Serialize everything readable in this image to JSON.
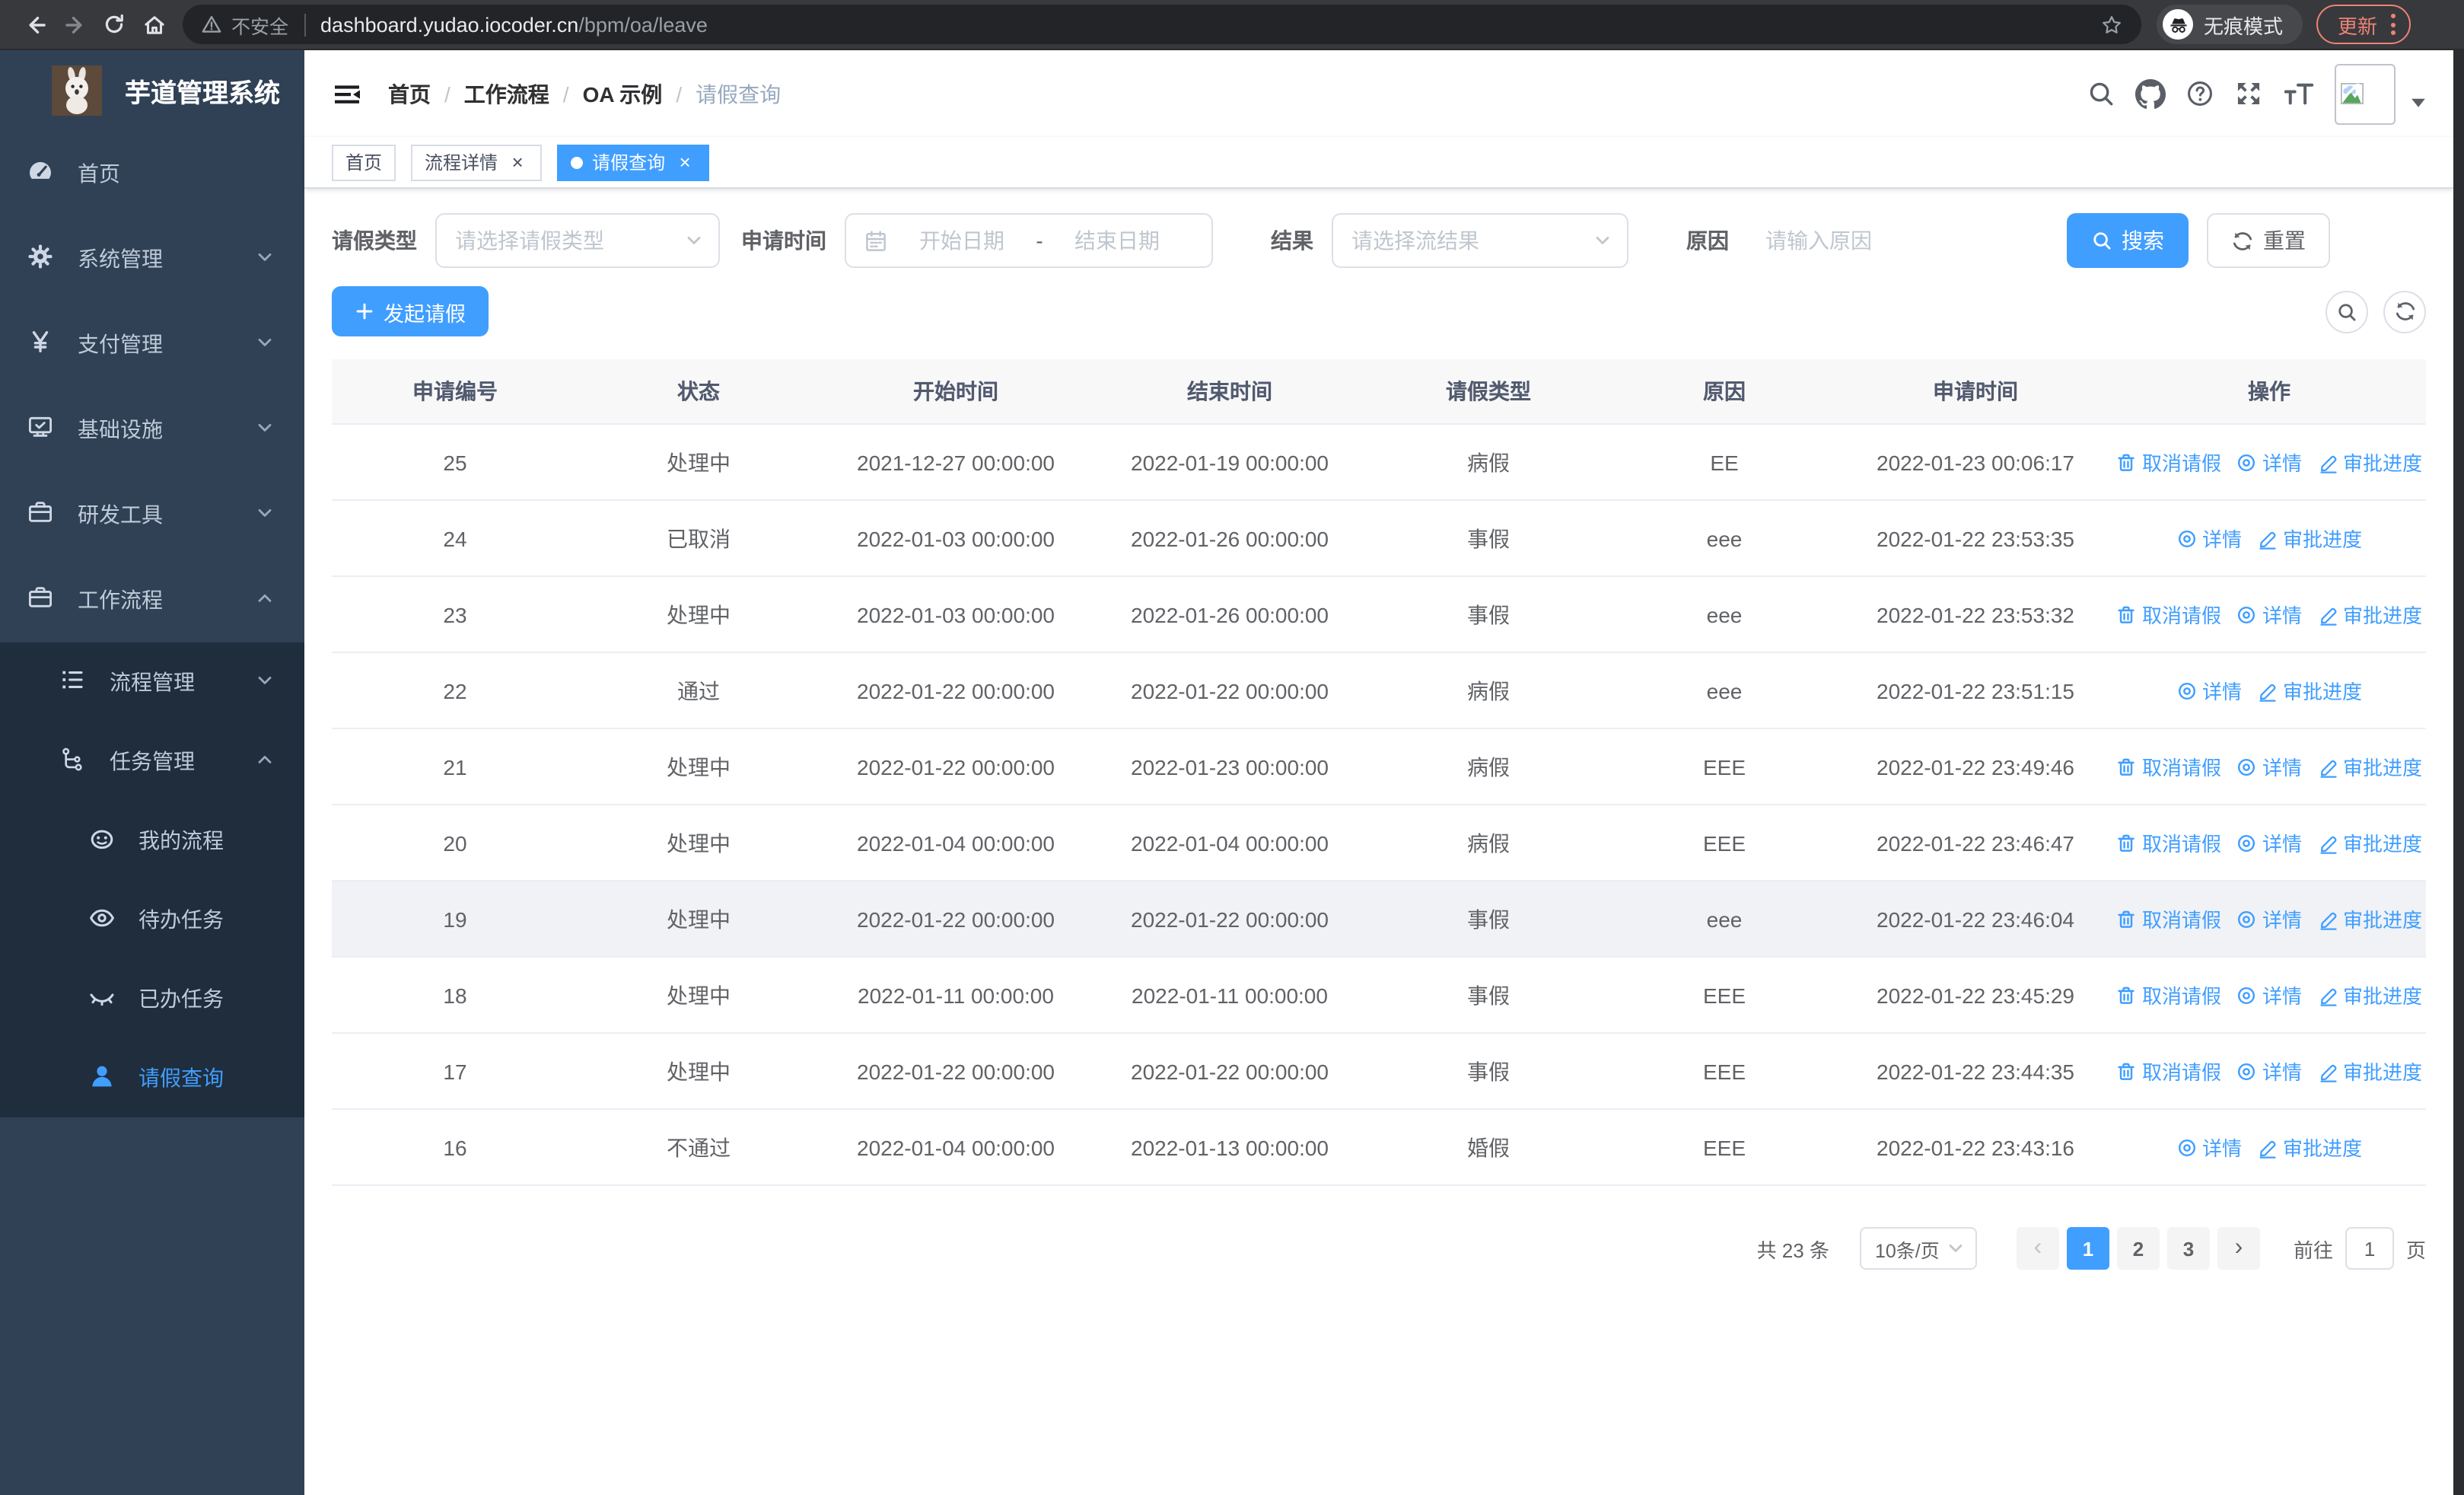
{
  "browser": {
    "security_label": "不安全",
    "url_host": "dashboard.yudao.iocoder.cn",
    "url_path": "/bpm/oa/leave",
    "incognito_label": "无痕模式",
    "update_label": "更新"
  },
  "app": {
    "title": "芋道管理系统"
  },
  "sidebar": {
    "menu": [
      {
        "name": "home",
        "label": "首页",
        "icon": "dashboard-icon",
        "arrow": null,
        "active": false
      },
      {
        "name": "system",
        "label": "系统管理",
        "icon": "gear-icon",
        "arrow": "down",
        "active": false
      },
      {
        "name": "payment",
        "label": "支付管理",
        "icon": "yen-icon",
        "arrow": "down",
        "active": false
      },
      {
        "name": "infrastructure",
        "label": "基础设施",
        "icon": "monitor-icon",
        "arrow": "down",
        "active": false
      },
      {
        "name": "devtools",
        "label": "研发工具",
        "icon": "briefcase-icon",
        "arrow": "down",
        "active": false
      },
      {
        "name": "workflow",
        "label": "工作流程",
        "icon": "briefcase-icon",
        "arrow": "up",
        "active": false
      }
    ],
    "submenu": [
      {
        "name": "process-mgmt",
        "label": "流程管理",
        "icon": "list-icon",
        "arrow": "down",
        "level": 2,
        "active": false
      },
      {
        "name": "task-mgmt",
        "label": "任务管理",
        "icon": "flow-icon",
        "arrow": "up",
        "level": 2,
        "active": false
      },
      {
        "name": "my-process",
        "label": "我的流程",
        "icon": "robot-icon",
        "arrow": null,
        "level": 3,
        "active": false
      },
      {
        "name": "todo-tasks",
        "label": "待办任务",
        "icon": "eye-icon",
        "arrow": null,
        "level": 3,
        "active": false
      },
      {
        "name": "done-tasks",
        "label": "已办任务",
        "icon": "eye-closed-icon",
        "arrow": null,
        "level": 3,
        "active": false
      },
      {
        "name": "leave-query",
        "label": "请假查询",
        "icon": "user-icon",
        "arrow": null,
        "level": 3,
        "active": true
      }
    ]
  },
  "breadcrumb": [
    "首页",
    "工作流程",
    "OA 示例",
    "请假查询"
  ],
  "header_icons": [
    "search-icon",
    "github-icon",
    "help-icon",
    "fullscreen-icon",
    "font-size-icon"
  ],
  "tabs": [
    {
      "label": "首页",
      "closable": false,
      "active": false
    },
    {
      "label": "流程详情",
      "closable": true,
      "active": false
    },
    {
      "label": "请假查询",
      "closable": true,
      "active": true
    }
  ],
  "filters": {
    "type_label": "请假类型",
    "type_placeholder": "请选择请假类型",
    "time_label": "申请时间",
    "start_placeholder": "开始日期",
    "range_separator": "-",
    "end_placeholder": "结束日期",
    "result_label": "结果",
    "result_placeholder": "请选择流结果",
    "reason_label": "原因",
    "reason_placeholder": "请输入原因",
    "search_label": "搜索",
    "reset_label": "重置"
  },
  "create_button": {
    "label": "发起请假"
  },
  "table": {
    "columns": [
      "申请编号",
      "状态",
      "开始时间",
      "结束时间",
      "请假类型",
      "原因",
      "申请时间",
      "操作"
    ],
    "action_labels": {
      "cancel": "取消请假",
      "detail": "详情",
      "progress": "审批进度"
    },
    "rows": [
      {
        "id": "25",
        "status": "处理中",
        "start_time": "2021-12-27 00:00:00",
        "end_time": "2022-01-19 00:00:00",
        "leave_type": "病假",
        "reason": "EE",
        "apply_time": "2022-01-23 00:06:17",
        "actions": [
          "cancel",
          "detail",
          "progress"
        ],
        "highlighted": false
      },
      {
        "id": "24",
        "status": "已取消",
        "start_time": "2022-01-03 00:00:00",
        "end_time": "2022-01-26 00:00:00",
        "leave_type": "事假",
        "reason": "eee",
        "apply_time": "2022-01-22 23:53:35",
        "actions": [
          "detail",
          "progress"
        ],
        "highlighted": false
      },
      {
        "id": "23",
        "status": "处理中",
        "start_time": "2022-01-03 00:00:00",
        "end_time": "2022-01-26 00:00:00",
        "leave_type": "事假",
        "reason": "eee",
        "apply_time": "2022-01-22 23:53:32",
        "actions": [
          "cancel",
          "detail",
          "progress"
        ],
        "highlighted": false
      },
      {
        "id": "22",
        "status": "通过",
        "start_time": "2022-01-22 00:00:00",
        "end_time": "2022-01-22 00:00:00",
        "leave_type": "病假",
        "reason": "eee",
        "apply_time": "2022-01-22 23:51:15",
        "actions": [
          "detail",
          "progress"
        ],
        "highlighted": false
      },
      {
        "id": "21",
        "status": "处理中",
        "start_time": "2022-01-22 00:00:00",
        "end_time": "2022-01-23 00:00:00",
        "leave_type": "病假",
        "reason": "EEE",
        "apply_time": "2022-01-22 23:49:46",
        "actions": [
          "cancel",
          "detail",
          "progress"
        ],
        "highlighted": false
      },
      {
        "id": "20",
        "status": "处理中",
        "start_time": "2022-01-04 00:00:00",
        "end_time": "2022-01-04 00:00:00",
        "leave_type": "病假",
        "reason": "EEE",
        "apply_time": "2022-01-22 23:46:47",
        "actions": [
          "cancel",
          "detail",
          "progress"
        ],
        "highlighted": false
      },
      {
        "id": "19",
        "status": "处理中",
        "start_time": "2022-01-22 00:00:00",
        "end_time": "2022-01-22 00:00:00",
        "leave_type": "事假",
        "reason": "eee",
        "apply_time": "2022-01-22 23:46:04",
        "actions": [
          "cancel",
          "detail",
          "progress"
        ],
        "highlighted": true
      },
      {
        "id": "18",
        "status": "处理中",
        "start_time": "2022-01-11 00:00:00",
        "end_time": "2022-01-11 00:00:00",
        "leave_type": "事假",
        "reason": "EEE",
        "apply_time": "2022-01-22 23:45:29",
        "actions": [
          "cancel",
          "detail",
          "progress"
        ],
        "highlighted": false
      },
      {
        "id": "17",
        "status": "处理中",
        "start_time": "2022-01-22 00:00:00",
        "end_time": "2022-01-22 00:00:00",
        "leave_type": "事假",
        "reason": "EEE",
        "apply_time": "2022-01-22 23:44:35",
        "actions": [
          "cancel",
          "detail",
          "progress"
        ],
        "highlighted": false
      },
      {
        "id": "16",
        "status": "不通过",
        "start_time": "2022-01-04 00:00:00",
        "end_time": "2022-01-13 00:00:00",
        "leave_type": "婚假",
        "reason": "EEE",
        "apply_time": "2022-01-22 23:43:16",
        "actions": [
          "detail",
          "progress"
        ],
        "highlighted": false
      }
    ]
  },
  "pagination": {
    "total_label": "共 23 条",
    "page_size_label": "10条/页",
    "pages": [
      "1",
      "2",
      "3"
    ],
    "active_page": "1",
    "goto_label": "前往",
    "goto_value": "1",
    "page_unit": "页"
  },
  "colors": {
    "accent": "#409eff",
    "sidebar_bg": "#304156",
    "submenu_bg": "#1f2d3d",
    "link": "#409eff",
    "update_badge": "#ee8277",
    "table_header_bg": "#f8f8f9",
    "row_hover_bg": "#f0f2f5"
  }
}
